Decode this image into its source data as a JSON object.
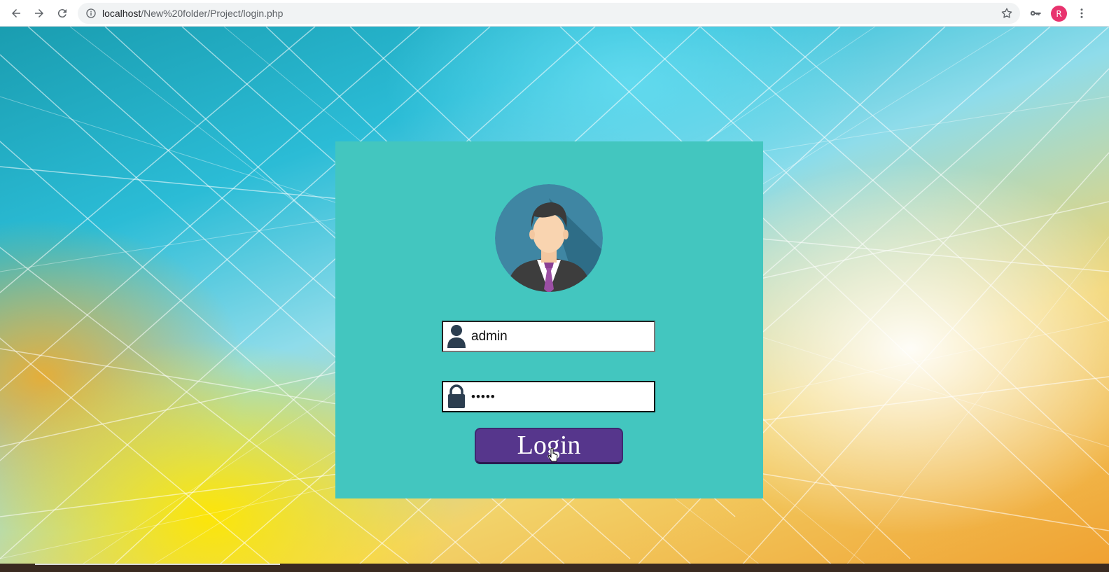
{
  "browser": {
    "url_host": "localhost",
    "url_path": "/New%20folder/Project/login.php",
    "profile_initial": "R",
    "icons": {
      "back": "arrow-left-icon",
      "forward": "arrow-right-icon",
      "reload": "reload-icon",
      "site_info": "info-icon",
      "bookmark": "star-icon",
      "passwords": "key-icon",
      "menu": "three-dot-menu-icon"
    },
    "colors": {
      "profile": "#e8336e",
      "omnibox": "#f1f3f4"
    }
  },
  "login": {
    "avatar_icon": "user-avatar-businessman-icon",
    "username": {
      "value": "admin",
      "icon": "user-icon"
    },
    "password": {
      "value": "admin",
      "icon": "lock-icon"
    },
    "button_label": "Login",
    "colors": {
      "card": "#43c6bf",
      "button": "#56368c",
      "icon": "#2c3e50"
    }
  }
}
